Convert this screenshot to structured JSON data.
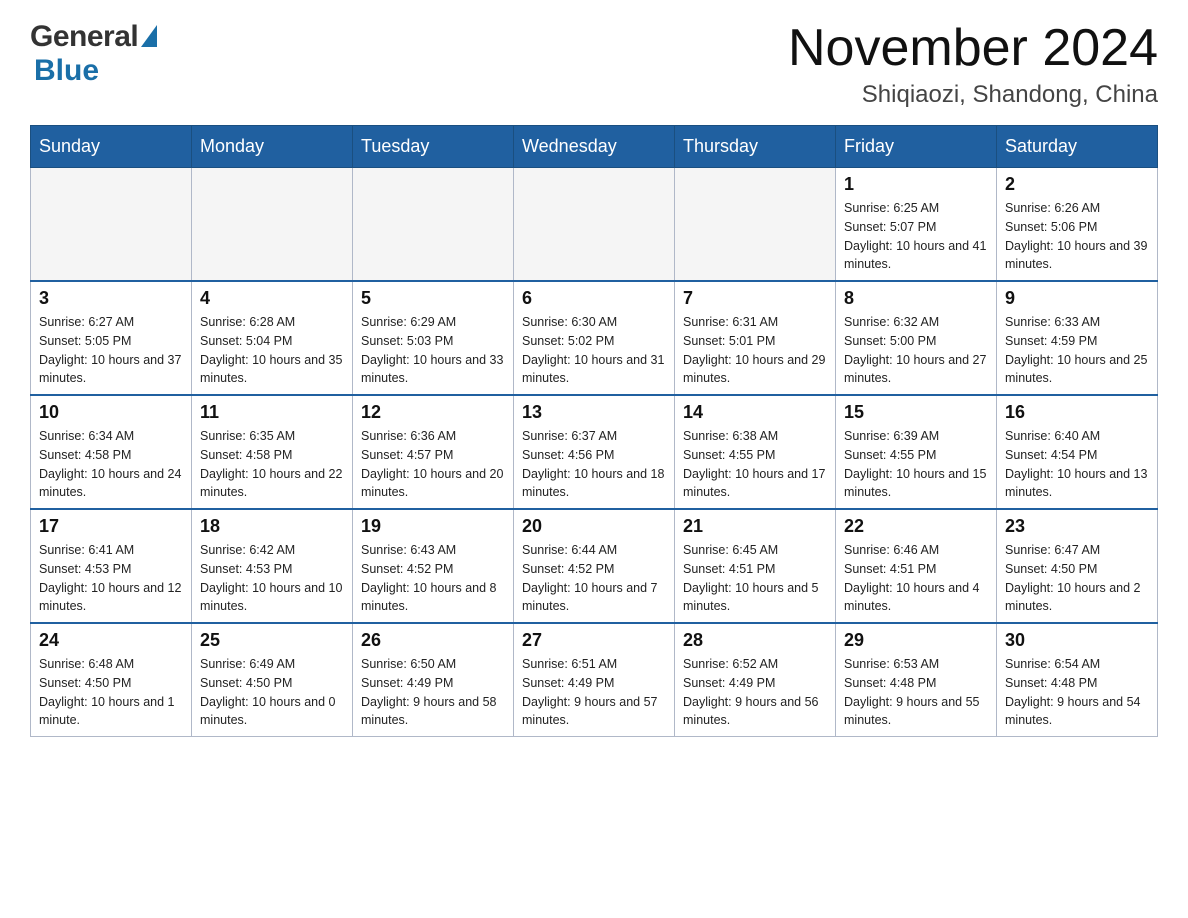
{
  "logo": {
    "general": "General",
    "blue": "Blue"
  },
  "header": {
    "month_title": "November 2024",
    "subtitle": "Shiqiaozi, Shandong, China"
  },
  "weekdays": [
    "Sunday",
    "Monday",
    "Tuesday",
    "Wednesday",
    "Thursday",
    "Friday",
    "Saturday"
  ],
  "weeks": [
    [
      {
        "day": "",
        "sunrise": "",
        "sunset": "",
        "daylight": "",
        "empty": true
      },
      {
        "day": "",
        "sunrise": "",
        "sunset": "",
        "daylight": "",
        "empty": true
      },
      {
        "day": "",
        "sunrise": "",
        "sunset": "",
        "daylight": "",
        "empty": true
      },
      {
        "day": "",
        "sunrise": "",
        "sunset": "",
        "daylight": "",
        "empty": true
      },
      {
        "day": "",
        "sunrise": "",
        "sunset": "",
        "daylight": "",
        "empty": true
      },
      {
        "day": "1",
        "sunrise": "Sunrise: 6:25 AM",
        "sunset": "Sunset: 5:07 PM",
        "daylight": "Daylight: 10 hours and 41 minutes.",
        "empty": false
      },
      {
        "day": "2",
        "sunrise": "Sunrise: 6:26 AM",
        "sunset": "Sunset: 5:06 PM",
        "daylight": "Daylight: 10 hours and 39 minutes.",
        "empty": false
      }
    ],
    [
      {
        "day": "3",
        "sunrise": "Sunrise: 6:27 AM",
        "sunset": "Sunset: 5:05 PM",
        "daylight": "Daylight: 10 hours and 37 minutes.",
        "empty": false
      },
      {
        "day": "4",
        "sunrise": "Sunrise: 6:28 AM",
        "sunset": "Sunset: 5:04 PM",
        "daylight": "Daylight: 10 hours and 35 minutes.",
        "empty": false
      },
      {
        "day": "5",
        "sunrise": "Sunrise: 6:29 AM",
        "sunset": "Sunset: 5:03 PM",
        "daylight": "Daylight: 10 hours and 33 minutes.",
        "empty": false
      },
      {
        "day": "6",
        "sunrise": "Sunrise: 6:30 AM",
        "sunset": "Sunset: 5:02 PM",
        "daylight": "Daylight: 10 hours and 31 minutes.",
        "empty": false
      },
      {
        "day": "7",
        "sunrise": "Sunrise: 6:31 AM",
        "sunset": "Sunset: 5:01 PM",
        "daylight": "Daylight: 10 hours and 29 minutes.",
        "empty": false
      },
      {
        "day": "8",
        "sunrise": "Sunrise: 6:32 AM",
        "sunset": "Sunset: 5:00 PM",
        "daylight": "Daylight: 10 hours and 27 minutes.",
        "empty": false
      },
      {
        "day": "9",
        "sunrise": "Sunrise: 6:33 AM",
        "sunset": "Sunset: 4:59 PM",
        "daylight": "Daylight: 10 hours and 25 minutes.",
        "empty": false
      }
    ],
    [
      {
        "day": "10",
        "sunrise": "Sunrise: 6:34 AM",
        "sunset": "Sunset: 4:58 PM",
        "daylight": "Daylight: 10 hours and 24 minutes.",
        "empty": false
      },
      {
        "day": "11",
        "sunrise": "Sunrise: 6:35 AM",
        "sunset": "Sunset: 4:58 PM",
        "daylight": "Daylight: 10 hours and 22 minutes.",
        "empty": false
      },
      {
        "day": "12",
        "sunrise": "Sunrise: 6:36 AM",
        "sunset": "Sunset: 4:57 PM",
        "daylight": "Daylight: 10 hours and 20 minutes.",
        "empty": false
      },
      {
        "day": "13",
        "sunrise": "Sunrise: 6:37 AM",
        "sunset": "Sunset: 4:56 PM",
        "daylight": "Daylight: 10 hours and 18 minutes.",
        "empty": false
      },
      {
        "day": "14",
        "sunrise": "Sunrise: 6:38 AM",
        "sunset": "Sunset: 4:55 PM",
        "daylight": "Daylight: 10 hours and 17 minutes.",
        "empty": false
      },
      {
        "day": "15",
        "sunrise": "Sunrise: 6:39 AM",
        "sunset": "Sunset: 4:55 PM",
        "daylight": "Daylight: 10 hours and 15 minutes.",
        "empty": false
      },
      {
        "day": "16",
        "sunrise": "Sunrise: 6:40 AM",
        "sunset": "Sunset: 4:54 PM",
        "daylight": "Daylight: 10 hours and 13 minutes.",
        "empty": false
      }
    ],
    [
      {
        "day": "17",
        "sunrise": "Sunrise: 6:41 AM",
        "sunset": "Sunset: 4:53 PM",
        "daylight": "Daylight: 10 hours and 12 minutes.",
        "empty": false
      },
      {
        "day": "18",
        "sunrise": "Sunrise: 6:42 AM",
        "sunset": "Sunset: 4:53 PM",
        "daylight": "Daylight: 10 hours and 10 minutes.",
        "empty": false
      },
      {
        "day": "19",
        "sunrise": "Sunrise: 6:43 AM",
        "sunset": "Sunset: 4:52 PM",
        "daylight": "Daylight: 10 hours and 8 minutes.",
        "empty": false
      },
      {
        "day": "20",
        "sunrise": "Sunrise: 6:44 AM",
        "sunset": "Sunset: 4:52 PM",
        "daylight": "Daylight: 10 hours and 7 minutes.",
        "empty": false
      },
      {
        "day": "21",
        "sunrise": "Sunrise: 6:45 AM",
        "sunset": "Sunset: 4:51 PM",
        "daylight": "Daylight: 10 hours and 5 minutes.",
        "empty": false
      },
      {
        "day": "22",
        "sunrise": "Sunrise: 6:46 AM",
        "sunset": "Sunset: 4:51 PM",
        "daylight": "Daylight: 10 hours and 4 minutes.",
        "empty": false
      },
      {
        "day": "23",
        "sunrise": "Sunrise: 6:47 AM",
        "sunset": "Sunset: 4:50 PM",
        "daylight": "Daylight: 10 hours and 2 minutes.",
        "empty": false
      }
    ],
    [
      {
        "day": "24",
        "sunrise": "Sunrise: 6:48 AM",
        "sunset": "Sunset: 4:50 PM",
        "daylight": "Daylight: 10 hours and 1 minute.",
        "empty": false
      },
      {
        "day": "25",
        "sunrise": "Sunrise: 6:49 AM",
        "sunset": "Sunset: 4:50 PM",
        "daylight": "Daylight: 10 hours and 0 minutes.",
        "empty": false
      },
      {
        "day": "26",
        "sunrise": "Sunrise: 6:50 AM",
        "sunset": "Sunset: 4:49 PM",
        "daylight": "Daylight: 9 hours and 58 minutes.",
        "empty": false
      },
      {
        "day": "27",
        "sunrise": "Sunrise: 6:51 AM",
        "sunset": "Sunset: 4:49 PM",
        "daylight": "Daylight: 9 hours and 57 minutes.",
        "empty": false
      },
      {
        "day": "28",
        "sunrise": "Sunrise: 6:52 AM",
        "sunset": "Sunset: 4:49 PM",
        "daylight": "Daylight: 9 hours and 56 minutes.",
        "empty": false
      },
      {
        "day": "29",
        "sunrise": "Sunrise: 6:53 AM",
        "sunset": "Sunset: 4:48 PM",
        "daylight": "Daylight: 9 hours and 55 minutes.",
        "empty": false
      },
      {
        "day": "30",
        "sunrise": "Sunrise: 6:54 AM",
        "sunset": "Sunset: 4:48 PM",
        "daylight": "Daylight: 9 hours and 54 minutes.",
        "empty": false
      }
    ]
  ]
}
